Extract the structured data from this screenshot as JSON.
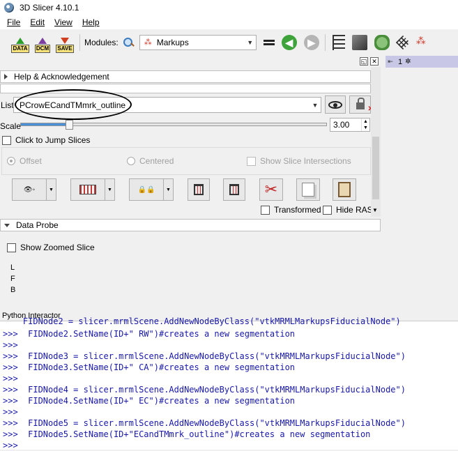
{
  "window": {
    "title": "3D Slicer 4.10.1"
  },
  "menu": [
    "File",
    "Edit",
    "View",
    "Help"
  ],
  "toolbar": {
    "data_label": "DATA",
    "dcm_label": "DCM",
    "save_label": "SAVE",
    "modules_label": "Modules:",
    "module_selected": "Markups"
  },
  "panel": {
    "help_section": "Help & Acknowledgement",
    "list_label": "List",
    "list_value": "PCrowECandTMmrk_outline",
    "scale_label": "Scale",
    "scale_value": "3.00",
    "scale_fraction": 0.16,
    "click_to_jump": "Click to Jump Slices",
    "offset_label": "Offset",
    "centered_label": "Centered",
    "show_slice_intersections": "Show Slice Intersections",
    "transformed_label": "Transformed",
    "hide_ras_label": "Hide RAS",
    "data_probe": "Data Probe",
    "show_zoomed_slice": "Show Zoomed Slice",
    "probe_rows": [
      "L",
      "F",
      "B"
    ]
  },
  "view_bar": {
    "number": "1"
  },
  "python": {
    "label": "Python Interactor",
    "cut_line": "    FIDNode2 = slicer.mrmlScene.AddNewNodeByClass(\"vtkMRMLMarkupsFiducialNode\")",
    "lines": [
      ">>>  FIDNode2.SetName(ID+\" RW\")#creates a new segmentation",
      ">>>",
      ">>>  FIDNode3 = slicer.mrmlScene.AddNewNodeByClass(\"vtkMRMLMarkupsFiducialNode\")",
      ">>>  FIDNode3.SetName(ID+\" CA\")#creates a new segmentation",
      ">>>",
      ">>>  FIDNode4 = slicer.mrmlScene.AddNewNodeByClass(\"vtkMRMLMarkupsFiducialNode\")",
      ">>>  FIDNode4.SetName(ID+\" EC\")#creates a new segmentation",
      ">>>",
      ">>>  FIDNode5 = slicer.mrmlScene.AddNewNodeByClass(\"vtkMRMLMarkupsFiducialNode\")",
      ">>>  FIDNode5.SetName(ID+\"ECandTMmrk_outline\")#creates a new segmentation",
      ">>>"
    ]
  },
  "colors": {
    "console_text": "#1818a8",
    "view_bar": "#c8c8e6",
    "slider_fill": "#4a90d9"
  }
}
